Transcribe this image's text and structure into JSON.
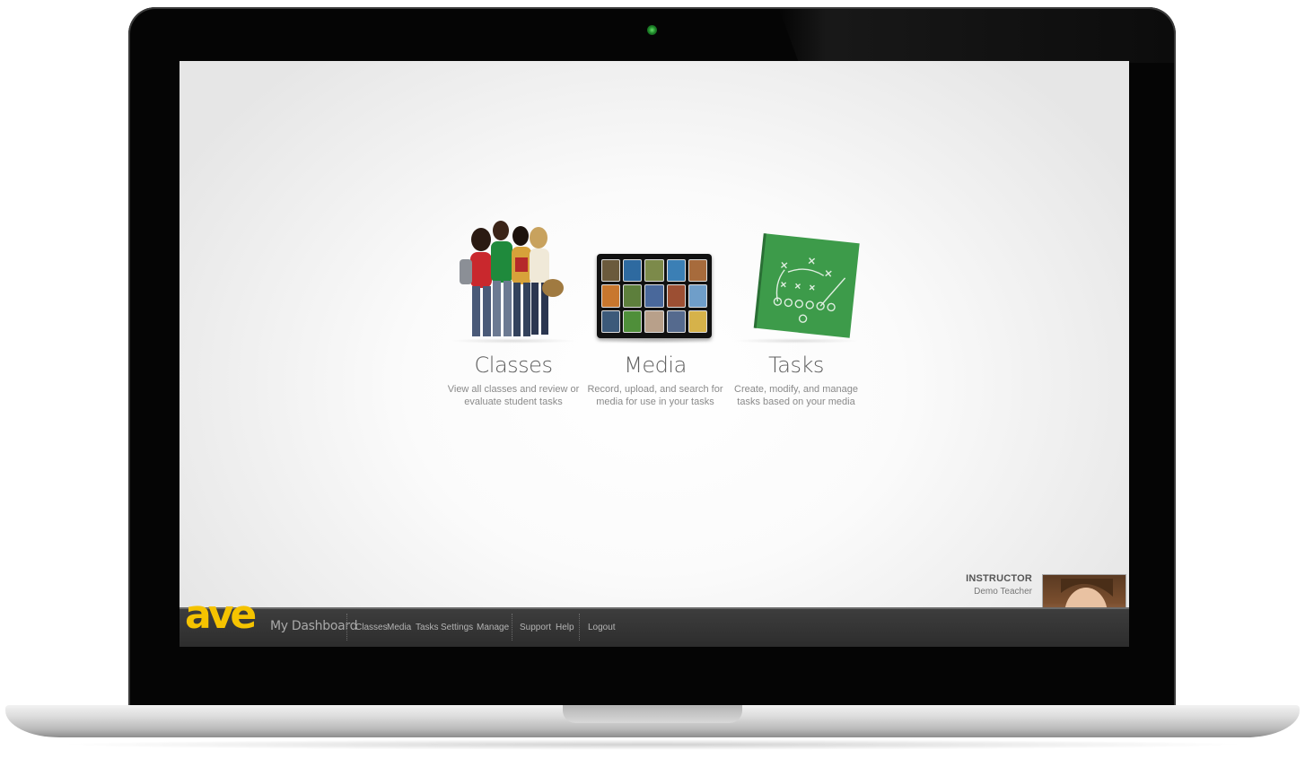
{
  "app": {
    "brand_label": "My Dashboard",
    "logo_text": "ave"
  },
  "tiles": [
    {
      "title": "Classes",
      "description": "View all classes and review or evaluate student tasks"
    },
    {
      "title": "Media",
      "description": "Record, upload, and search for media for use in your tasks"
    },
    {
      "title": "Tasks",
      "description": "Create, modify, and manage tasks based on your media"
    }
  ],
  "nav": {
    "primary": [
      "Classes",
      "Media",
      "Tasks",
      "Settings",
      "Manage"
    ],
    "secondary": [
      "Support",
      "Help"
    ],
    "logout": "Logout"
  },
  "user": {
    "role": "INSTRUCTOR",
    "name": "Demo Teacher"
  },
  "colors": {
    "logo_yellow": "#f5c300",
    "navbar": "#2f2f2f",
    "board_green": "#3d9b4a"
  },
  "icons": [
    "students-photo",
    "media-tablet-icon",
    "playbook-board-icon",
    "webcam-indicator"
  ]
}
